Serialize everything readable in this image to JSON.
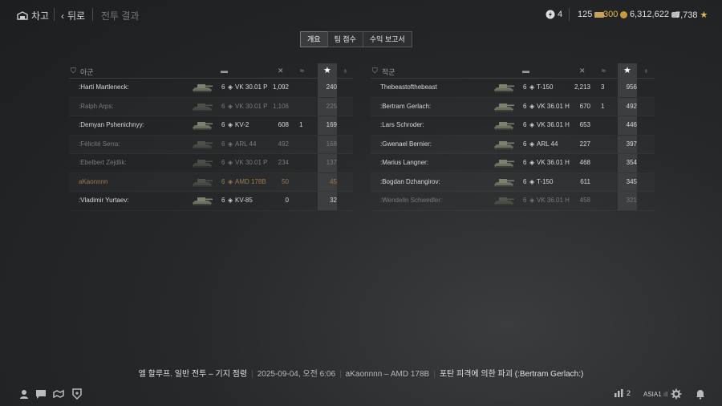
{
  "header": {
    "garage_label": "차고",
    "back_label": "뒤로",
    "page_title": "전투 결과",
    "bonds": "4",
    "credits_small": "125",
    "gold": "300",
    "silver": "6,312,622",
    "free_xp": "7,738"
  },
  "tabs": [
    {
      "label": "개요",
      "active": true
    },
    {
      "label": "팀 점수",
      "active": false
    },
    {
      "label": "수익 보고서",
      "active": false
    }
  ],
  "allies": {
    "title": "아군",
    "rows": [
      {
        "name": ":Harti Martleneck:",
        "tier": "6",
        "tank": "VK 30.01 P",
        "damage": "1,092",
        "assist": "",
        "xp": "240",
        "state": "alive"
      },
      {
        "name": ":Ralph Arps:",
        "tier": "6",
        "tank": "VK 30.01 P",
        "damage": "1,106",
        "assist": "",
        "xp": "225",
        "state": "dead"
      },
      {
        "name": ":Demyan Pshenichnyy:",
        "tier": "6",
        "tank": "KV-2",
        "damage": "608",
        "assist": "1",
        "xp": "169",
        "state": "alive"
      },
      {
        "name": ":Félicité Serra:",
        "tier": "6",
        "tank": "ARL 44",
        "damage": "492",
        "assist": "",
        "xp": "168",
        "state": "dead"
      },
      {
        "name": ":Ebelbert Zejdlik:",
        "tier": "6",
        "tank": "VK 30.01 P",
        "damage": "234",
        "assist": "",
        "xp": "137",
        "state": "dead"
      },
      {
        "name": "aKaonnnn",
        "tier": "6",
        "tank": "AMD 178B",
        "damage": "50",
        "assist": "",
        "xp": "45",
        "state": "me"
      },
      {
        "name": ":Vladimir Yurtaev:",
        "tier": "6",
        "tank": "KV-85",
        "damage": "0",
        "assist": "",
        "xp": "32",
        "state": "alive"
      }
    ]
  },
  "enemies": {
    "title": "적군",
    "rows": [
      {
        "name": "Thebeastofthebeast",
        "tier": "6",
        "tank": "T-150",
        "damage": "2,213",
        "assist": "3",
        "xp": "956",
        "state": "alive"
      },
      {
        "name": ":Bertram Gerlach:",
        "tier": "6",
        "tank": "VK 36.01 H",
        "damage": "670",
        "assist": "1",
        "xp": "492",
        "state": "alive"
      },
      {
        "name": ":Lars Schroder:",
        "tier": "6",
        "tank": "VK 36.01 H",
        "damage": "653",
        "assist": "",
        "xp": "446",
        "state": "alive"
      },
      {
        "name": ":Gwenael Bernier:",
        "tier": "6",
        "tank": "ARL 44",
        "damage": "227",
        "assist": "",
        "xp": "397",
        "state": "alive"
      },
      {
        "name": ":Marius Langner:",
        "tier": "6",
        "tank": "VK 36.01 H",
        "damage": "468",
        "assist": "",
        "xp": "354",
        "state": "alive"
      },
      {
        "name": ":Bogdan Dzhangirov:",
        "tier": "6",
        "tank": "T-150",
        "damage": "611",
        "assist": "",
        "xp": "345",
        "state": "alive"
      },
      {
        "name": ":Wendelin Schwedler:",
        "tier": "6",
        "tank": "VK 36.01 H",
        "damage": "458",
        "assist": "",
        "xp": "321",
        "state": "dead"
      }
    ]
  },
  "footer": {
    "battle": "엘 할루프. 일반 전투 – 기지 점령",
    "datetime": "2025-09-04, 오전 6:06",
    "player": "aKaonnnn – AMD 178B",
    "result": "포탄 피격에 의한 파괴 (:Bertram Gerlach:)"
  },
  "bottombar": {
    "online_count": "2",
    "server": "ASIA1"
  },
  "icons": [
    "garage-icon",
    "chevron-left-icon",
    "bond-icon",
    "credit-icon",
    "gold-icon",
    "silver-icon",
    "star-icon",
    "shield-icon",
    "tank-icon",
    "damage-icon",
    "assist-icon",
    "medal-icon",
    "profile-icon",
    "chat-icon",
    "handshake-icon",
    "clan-icon",
    "stats-icon",
    "settings-icon",
    "bell-icon"
  ]
}
